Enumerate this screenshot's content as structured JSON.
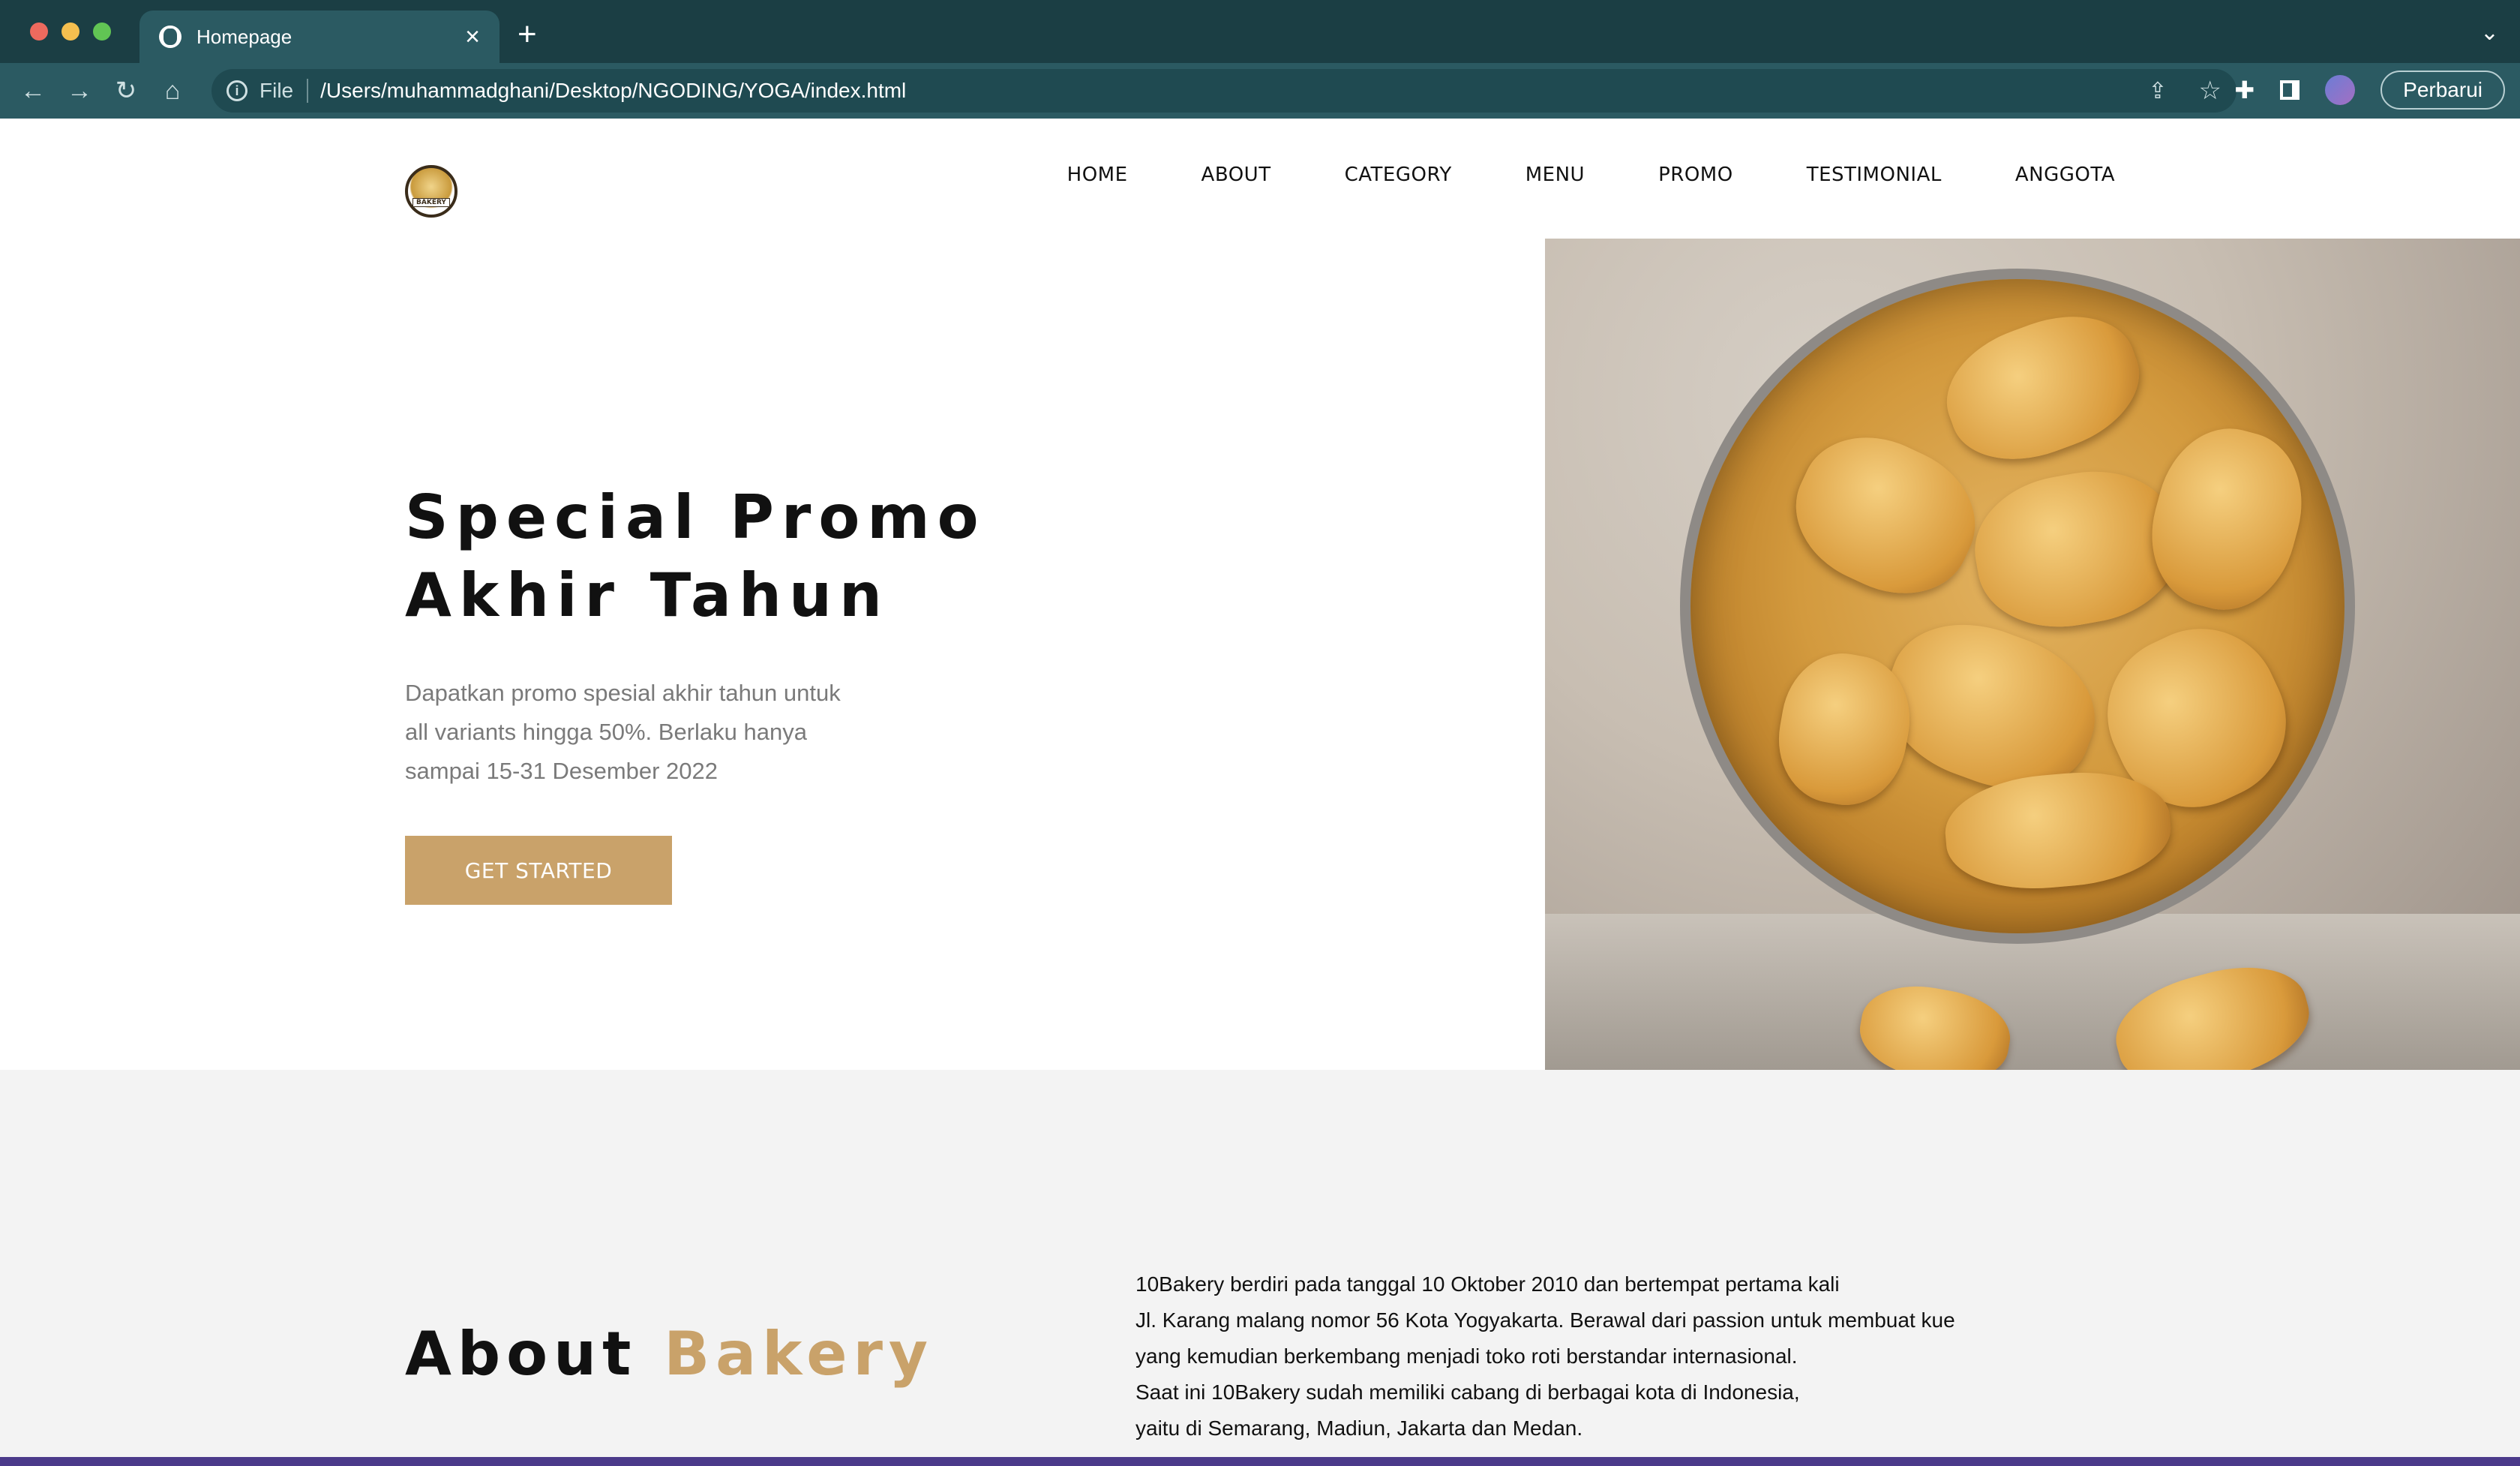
{
  "browser": {
    "tab_title": "Homepage",
    "url_scheme": "File",
    "url": "/Users/muhammadghani/Desktop/NGODING/YOGA/index.html",
    "update_button": "Perbarui"
  },
  "site": {
    "logo_text": "BAKERY",
    "nav": [
      "HOME",
      "ABOUT",
      "CATEGORY",
      "MENU",
      "PROMO",
      "TESTIMONIAL",
      "ANGGOTA"
    ],
    "hero": {
      "title": "Special Promo Akhir Tahun",
      "subtitle": "Dapatkan promo spesial akhir tahun untuk all variants hingga 50%. Berlaku hanya sampai 15-31 Desember 2022",
      "cta": "GET STARTED"
    },
    "about": {
      "title_main": "About",
      "title_accent": "Bakery",
      "lines": [
        "10Bakery berdiri pada tanggal 10 Oktober 2010 dan bertempat pertama kali",
        "Jl. Karang malang nomor 56 Kota Yogyakarta. Berawal dari passion untuk membuat kue",
        "yang kemudian berkembang menjadi toko roti berstandar internasional.",
        "Saat ini 10Bakery sudah memiliki cabang di berbagai kota di Indonesia,",
        "yaitu di Semarang, Madiun, Jakarta dan Medan."
      ]
    }
  },
  "colors": {
    "accent": "#c9a26a",
    "chrome": "#1b3e44",
    "toolbar": "#2b5a62"
  },
  "icons": [
    "globe-icon",
    "close-icon",
    "plus-icon",
    "chevron-down-icon",
    "back-icon",
    "forward-icon",
    "reload-icon",
    "home-icon",
    "info-icon",
    "share-icon",
    "star-icon",
    "puzzle-icon",
    "sidepanel-icon"
  ]
}
